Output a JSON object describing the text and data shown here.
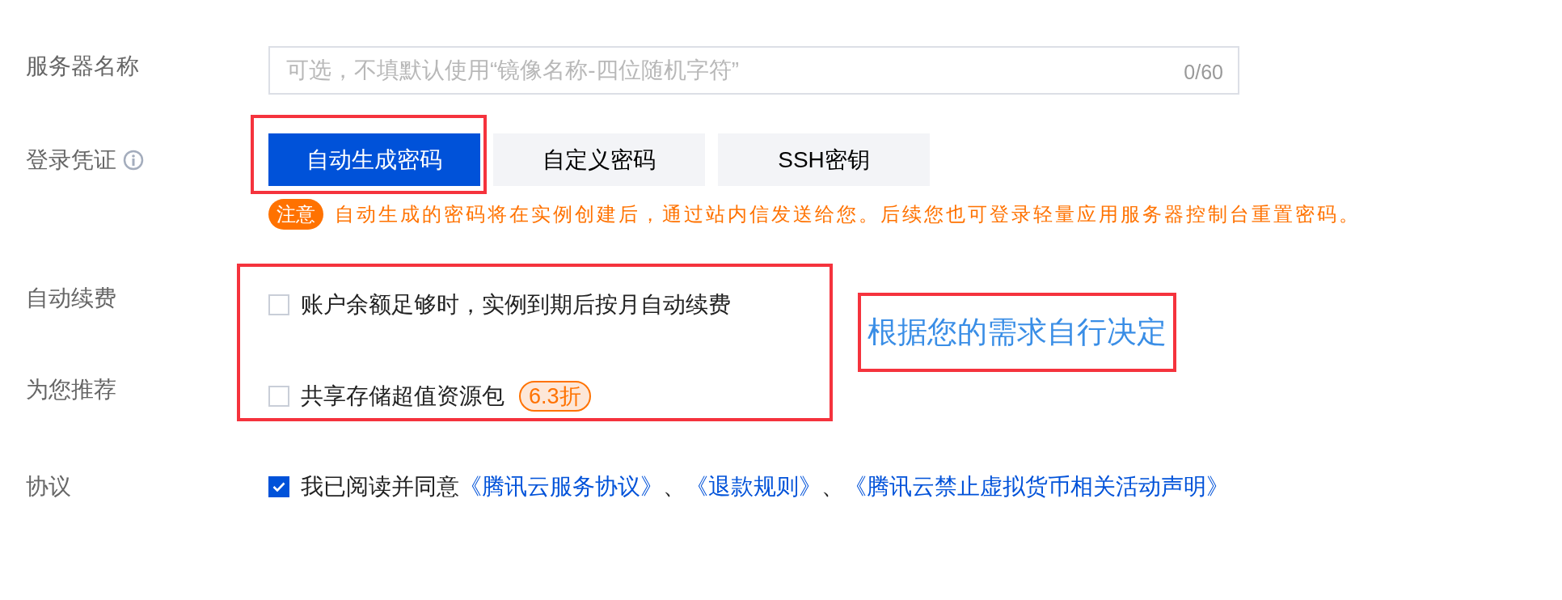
{
  "server_name": {
    "label": "服务器名称",
    "placeholder": "可选，不填默认使用“镜像名称-四位随机字符”",
    "counter": "0/60"
  },
  "login": {
    "label": "登录凭证",
    "options": [
      {
        "label": "自动生成密码",
        "selected": true,
        "annotated": true
      },
      {
        "label": "自定义密码",
        "selected": false,
        "annotated": false
      },
      {
        "label": "SSH密钥",
        "selected": false,
        "annotated": false
      }
    ],
    "note": {
      "badge": "注意",
      "text": "自动生成的密码将在实例创建后，通过站内信发送给您。后续您也可登录轻量应用服务器控制台重置密码。"
    }
  },
  "options": [
    {
      "label": "自动续费",
      "text": "账户余额足够时，实例到期后按月自动续费",
      "checked": false
    },
    {
      "label": "为您推荐",
      "text": "共享存储超值资源包",
      "checked": false,
      "badge": "6.3折"
    }
  ],
  "annotation": "根据您的需求自行决定",
  "agreement": {
    "label": "协议",
    "checked": true,
    "parts": [
      {
        "kind": "text",
        "text": "我已阅读并同意"
      },
      {
        "kind": "link",
        "text": "《腾讯云服务协议》"
      },
      {
        "kind": "text",
        "text": "、"
      },
      {
        "kind": "link",
        "text": "《退款规则》"
      },
      {
        "kind": "text",
        "text": "、"
      },
      {
        "kind": "link",
        "text": "《腾讯云禁止虚拟货币相关活动声明》"
      }
    ]
  }
}
